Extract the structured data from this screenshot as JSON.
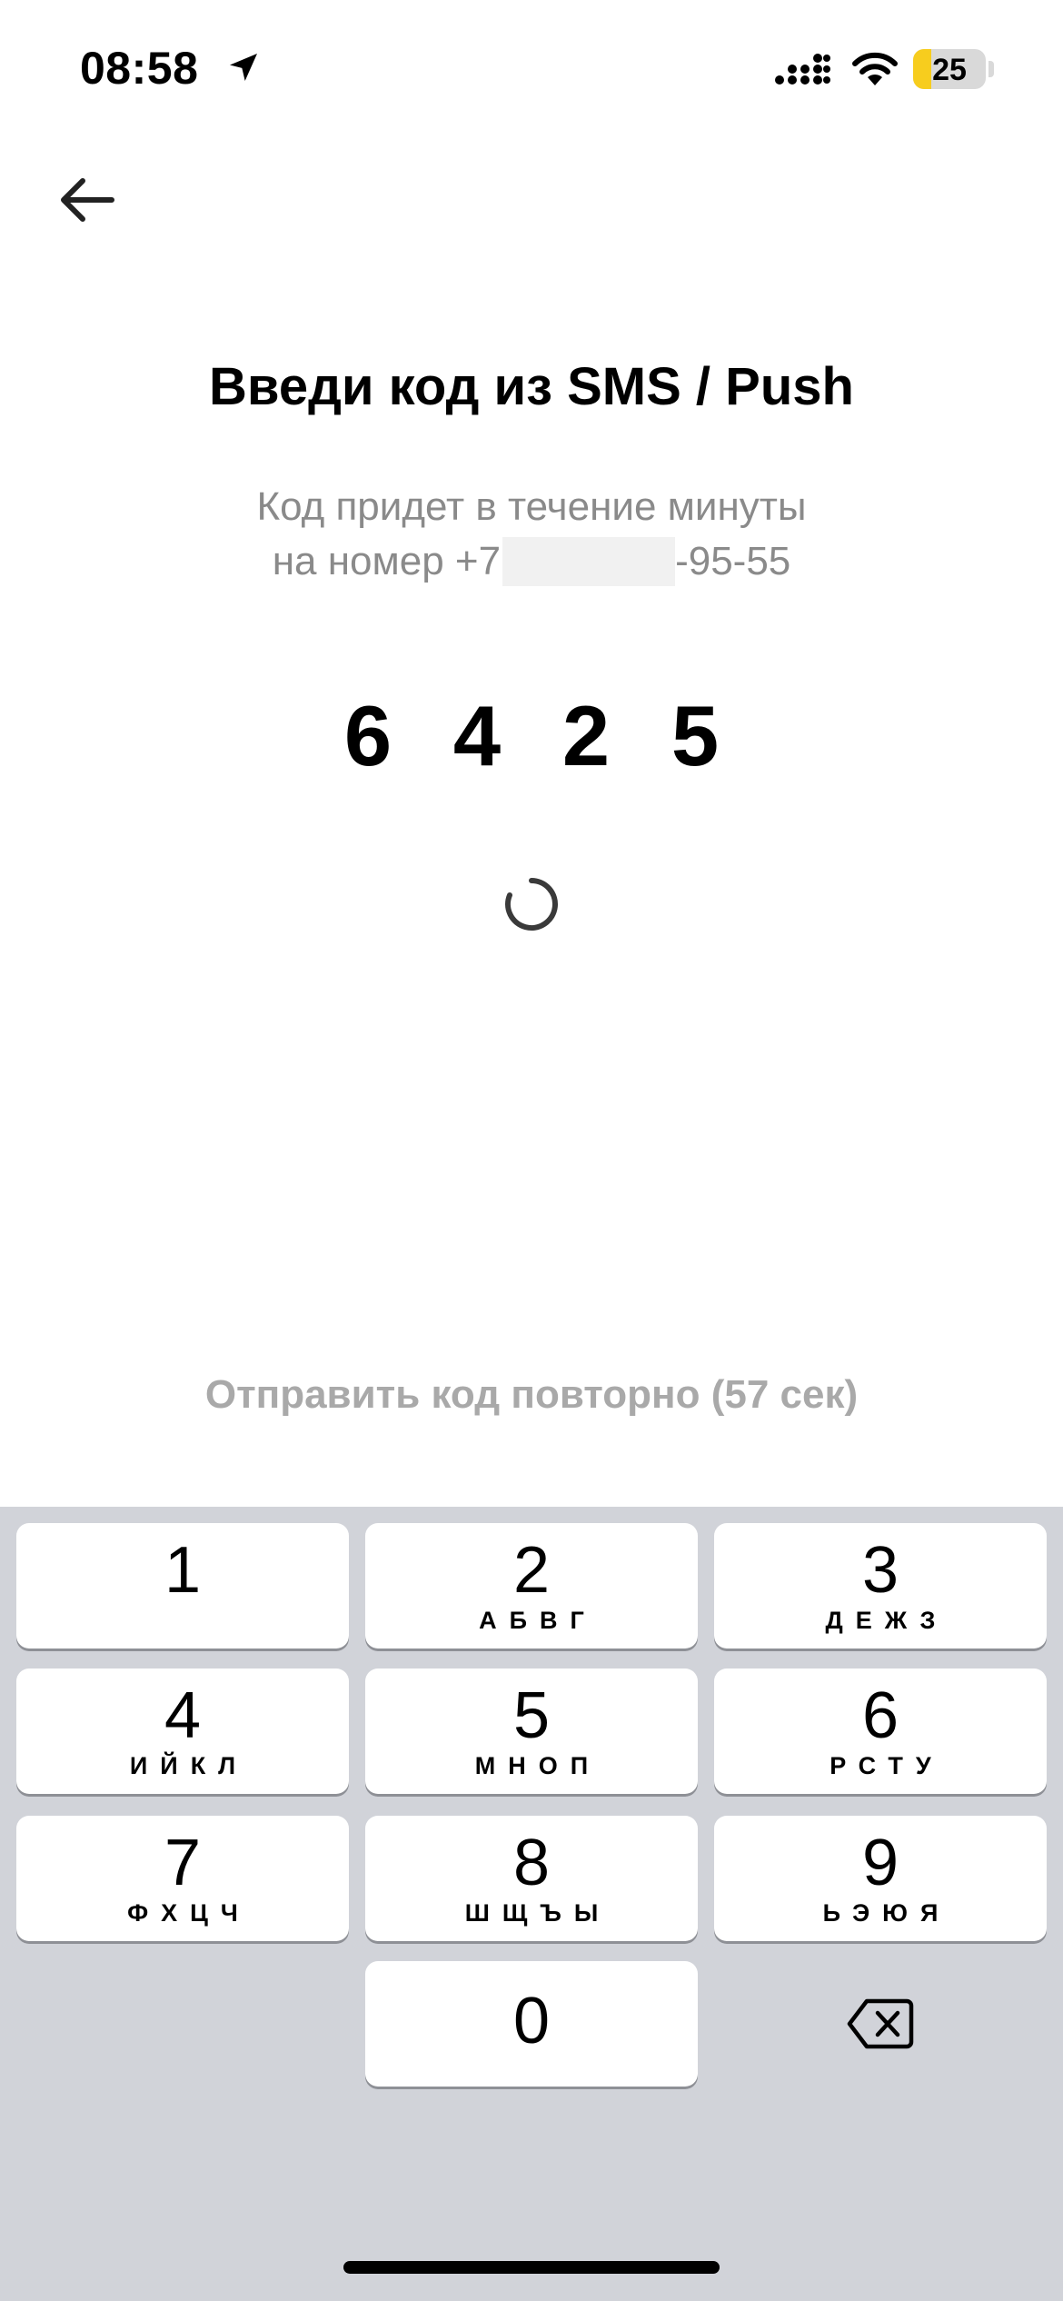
{
  "status_bar": {
    "time": "08:58",
    "battery_level": "25",
    "battery_fraction": 0.25,
    "battery_color": "#f7cd1e"
  },
  "header": {
    "title": "Введи код из SMS / Push",
    "subtitle_line1": "Код придет в течение минуты",
    "subtitle_line2_prefix": "на номер +7",
    "subtitle_line2_suffix": "-95-55"
  },
  "code": {
    "digits": [
      "6",
      "4",
      "2",
      "5"
    ]
  },
  "resend": {
    "label": "Отправить код повторно (57 сек)"
  },
  "keyboard": {
    "keys": [
      {
        "num": "1",
        "letters": ""
      },
      {
        "num": "2",
        "letters": "АБВГ"
      },
      {
        "num": "3",
        "letters": "ДЕЖЗ"
      },
      {
        "num": "4",
        "letters": "ИЙКЛ"
      },
      {
        "num": "5",
        "letters": "МНОП"
      },
      {
        "num": "6",
        "letters": "РСТУ"
      },
      {
        "num": "7",
        "letters": "ФХЦЧ"
      },
      {
        "num": "8",
        "letters": "ШЩЪЫ"
      },
      {
        "num": "9",
        "letters": "ЬЭЮЯ"
      },
      {
        "num": "0",
        "letters": ""
      }
    ],
    "delete_icon": "delete-backspace-icon"
  },
  "icons": {
    "back": "arrow-left-icon",
    "location": "location-arrow-icon",
    "signal": "cellular-signal-icon",
    "wifi": "wifi-icon",
    "spinner": "loading-spinner-icon"
  }
}
